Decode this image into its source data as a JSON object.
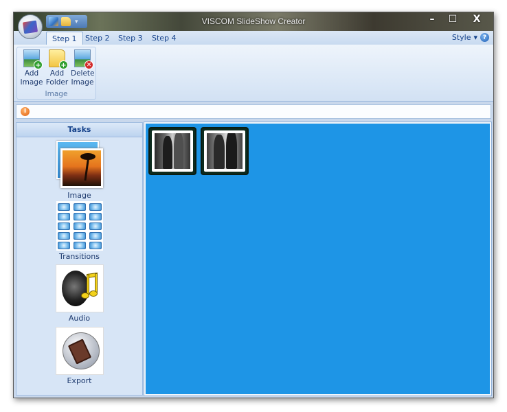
{
  "window": {
    "title": "VISCOM SlideShow Creator"
  },
  "quick_access": {
    "icons": [
      "image-icon",
      "folder-icon",
      "dropdown-arrow-icon"
    ]
  },
  "window_controls": {
    "minimize": "–",
    "maximize": "☐",
    "close": "X"
  },
  "tabs": [
    {
      "label": "Step 1",
      "active": true
    },
    {
      "label": "Step 2",
      "active": false
    },
    {
      "label": "Step 3",
      "active": false
    },
    {
      "label": "Step 4",
      "active": false
    }
  ],
  "style_menu": {
    "label": "Style",
    "arrow": "▾",
    "help": "?"
  },
  "ribbon": {
    "group_label": "Image",
    "buttons": [
      {
        "line1": "Add",
        "line2": "Image",
        "icon": "add-image-icon"
      },
      {
        "line1": "Add",
        "line2": "Folder",
        "icon": "add-folder-icon"
      },
      {
        "line1": "Delete",
        "line2": "Image",
        "icon": "delete-image-icon"
      }
    ]
  },
  "infobar": {
    "icon": "i",
    "close": "✕"
  },
  "tasks": {
    "header": "Tasks",
    "items": [
      {
        "label": "Image",
        "icon": "image-task-icon"
      },
      {
        "label": "Transitions",
        "icon": "transitions-task-icon"
      },
      {
        "label": "Audio",
        "icon": "audio-task-icon"
      },
      {
        "label": "Export",
        "icon": "export-task-icon"
      }
    ]
  },
  "canvas": {
    "background": "#1e95e6",
    "photos": [
      {
        "name": "photo-1"
      },
      {
        "name": "photo-2"
      }
    ]
  }
}
